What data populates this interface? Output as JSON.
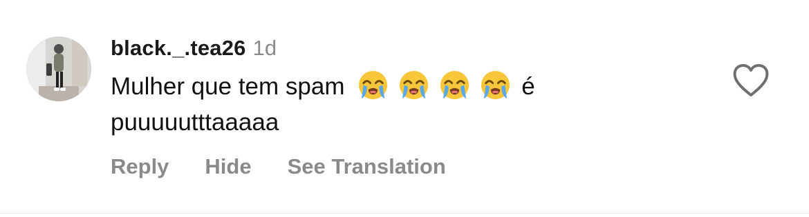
{
  "comment": {
    "username": "black._.tea26",
    "timestamp": "1d",
    "text_before_emojis": "Mulher que tem spam",
    "emojis": [
      "loudly-crying-face",
      "loudly-crying-face",
      "loudly-crying-face",
      "loudly-crying-face"
    ],
    "text_after_emojis": "é puuuuutttaaaaa",
    "like_icon": "heart-outline-icon"
  },
  "actions": {
    "reply_label": "Reply",
    "hide_label": "Hide",
    "see_translation_label": "See Translation"
  },
  "colors": {
    "username": "#1a1a1a",
    "text": "#111111",
    "secondary": "#8a8a8a",
    "divider": "#e3e3e3",
    "emoji_face": "#f7c63a",
    "emoji_tears": "#5aa9e6"
  }
}
